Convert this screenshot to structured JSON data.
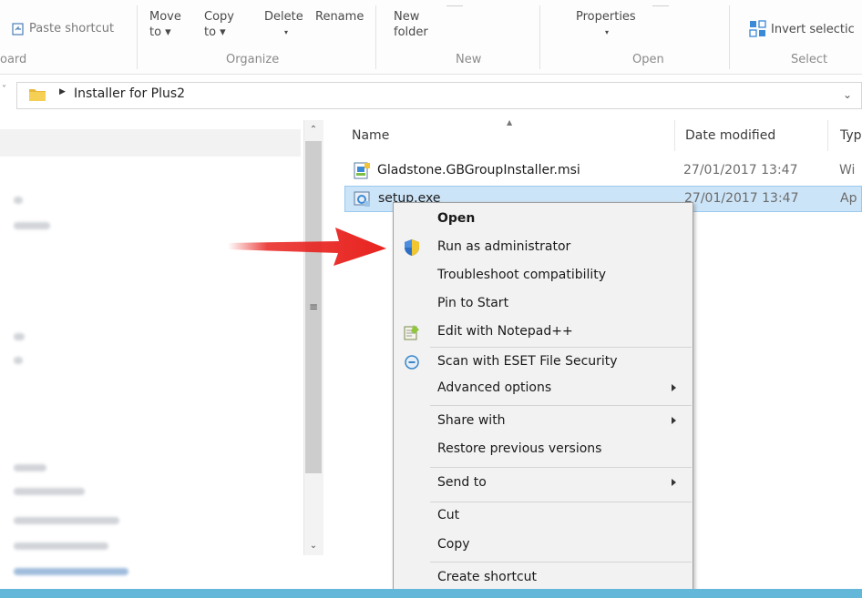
{
  "ribbon": {
    "clipboard": {
      "paste_shortcut": "Paste shortcut",
      "label": "oard"
    },
    "organize": {
      "move_to": [
        "Move",
        "to ▾"
      ],
      "copy_to": [
        "Copy",
        "to ▾"
      ],
      "delete": "Delete",
      "rename": "Rename",
      "label": "Organize"
    },
    "new": {
      "new_folder": [
        "New",
        "folder"
      ],
      "label": "New"
    },
    "open": {
      "properties": "Properties",
      "label": "Open"
    },
    "select": {
      "invert_selection": "Invert selectic",
      "label": "Select"
    }
  },
  "address": {
    "breadcrumb": "Installer for Plus2"
  },
  "columns": {
    "name": "Name",
    "date_modified": "Date modified",
    "type": "Typ"
  },
  "files": [
    {
      "name": "Gladstone.GBGroupInstaller.msi",
      "date": "27/01/2017 13:47",
      "type": "Wi",
      "selected": false
    },
    {
      "name": "setup.exe",
      "date": "27/01/2017 13:47",
      "type": "Ap",
      "selected": true
    }
  ],
  "context_menu": {
    "items": [
      {
        "label": "Open",
        "bold": true
      },
      {
        "label": "Run as administrator",
        "icon": "uac-shield-icon"
      },
      {
        "label": "Troubleshoot compatibility"
      },
      {
        "label": "Pin to Start"
      },
      {
        "label": "Edit with Notepad++",
        "icon": "notepad-plus-plus-icon"
      },
      {
        "label": "Scan with ESET File Security",
        "icon": "eset-icon"
      },
      {
        "label": "Advanced options",
        "submenu": true
      },
      {
        "label": "Share with",
        "submenu": true
      },
      {
        "label": "Restore previous versions"
      },
      {
        "label": "Send to",
        "submenu": true
      },
      {
        "label": "Cut"
      },
      {
        "label": "Copy"
      },
      {
        "label": "Create shortcut"
      }
    ]
  },
  "colors": {
    "selection": "#cce4f7",
    "arrow": "#e8231f",
    "taskbar": "#63b7d8"
  }
}
